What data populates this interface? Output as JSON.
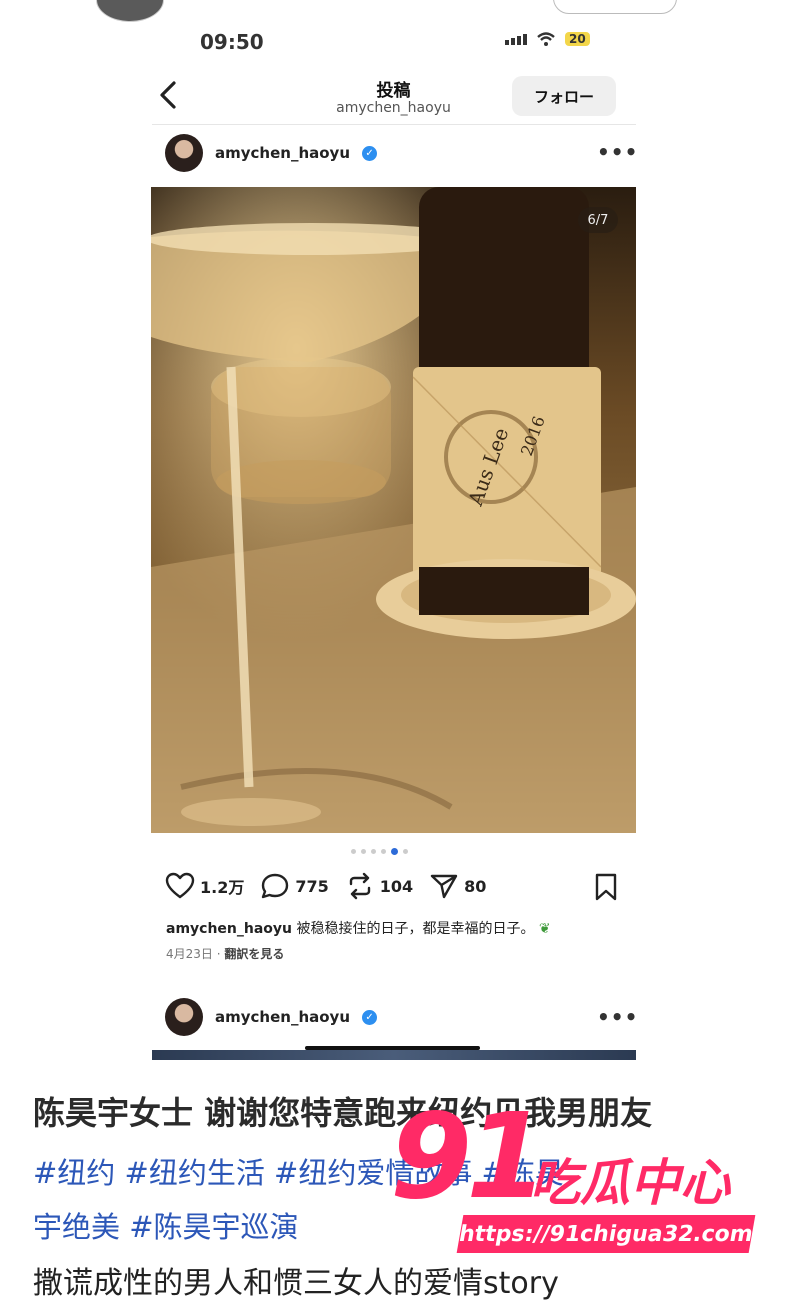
{
  "status": {
    "time": "09:50",
    "battery": "20"
  },
  "header": {
    "title": "投稿",
    "username": "amychen_haoyu",
    "follow_label": "フォロー"
  },
  "post": {
    "author": "amychen_haoyu",
    "counter": "6/7",
    "likes": "1.2万",
    "comments": "775",
    "reposts": "104",
    "shares": "80",
    "caption_user": "amychen_haoyu",
    "caption_text": "被稳稳接住的日子，都是幸福的日子。",
    "date": "4月23日",
    "translate_label": "翻訳を見る"
  },
  "post2": {
    "author": "amychen_haoyu"
  },
  "bottom": {
    "line1": "陈昊宇女士 谢谢您特意跑来纽约见我男朋友",
    "tags_line1": "#纽约 #纽约生活 #纽约爱情故事 #陈昊",
    "tags_line2": "宇绝美 #陈昊宇巡演",
    "line2": "撒谎成性的男人和惯三女人的爱情story"
  },
  "watermark": {
    "number": "91",
    "text": "吃瓜中心",
    "url": "https://91chigua32.com"
  },
  "colors": {
    "verify": "#2d8ff0",
    "hashtag": "#2c57b8",
    "watermark": "#ff2a66"
  }
}
